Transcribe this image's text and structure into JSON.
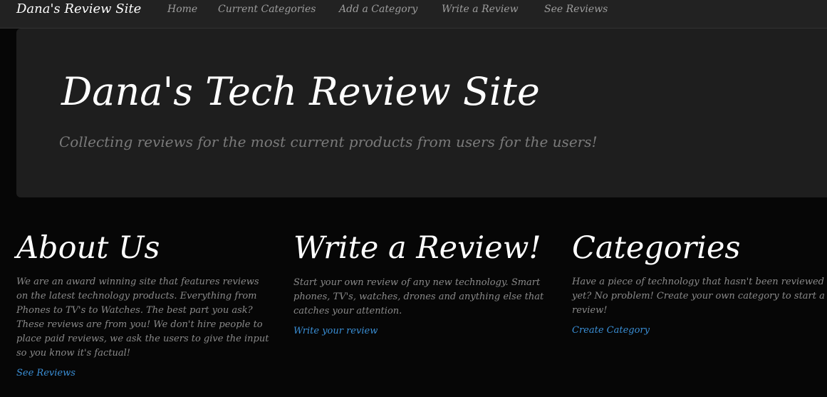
{
  "navbar": {
    "brand": "Dana's Review Site",
    "links": [
      "Home",
      "Current Categories",
      "Add a Category",
      "Write a Review",
      "See Reviews"
    ]
  },
  "hero": {
    "title": "Dana's Tech Review Site",
    "subtitle": "Collecting reviews for the most current products from users for the users!"
  },
  "columns": [
    {
      "heading": "About Us",
      "text": "We are an award winning site that features reviews on the latest technology products. Everything from Phones to TV's to Watches. The best part you ask? These reviews are from you! We don't hire people to place paid reviews, we ask the users to give the input so you know it's factual!",
      "link": "See Reviews"
    },
    {
      "heading": "Write a Review!",
      "text": "Start your own review of any new technology. Smart phones, TV's, watches, drones and anything else that catches your attention.",
      "link": "Write your review"
    },
    {
      "heading": "Categories",
      "text": "Have a piece of technology that hasn't been reviewed yet? No problem! Create your own category to start a review!",
      "link": "Create Category"
    }
  ],
  "colors": {
    "background": "#060606",
    "navbar": "#222222",
    "hero": "#1e1e1e",
    "link": "#3a8fd6",
    "text": "#8a8a8a"
  }
}
